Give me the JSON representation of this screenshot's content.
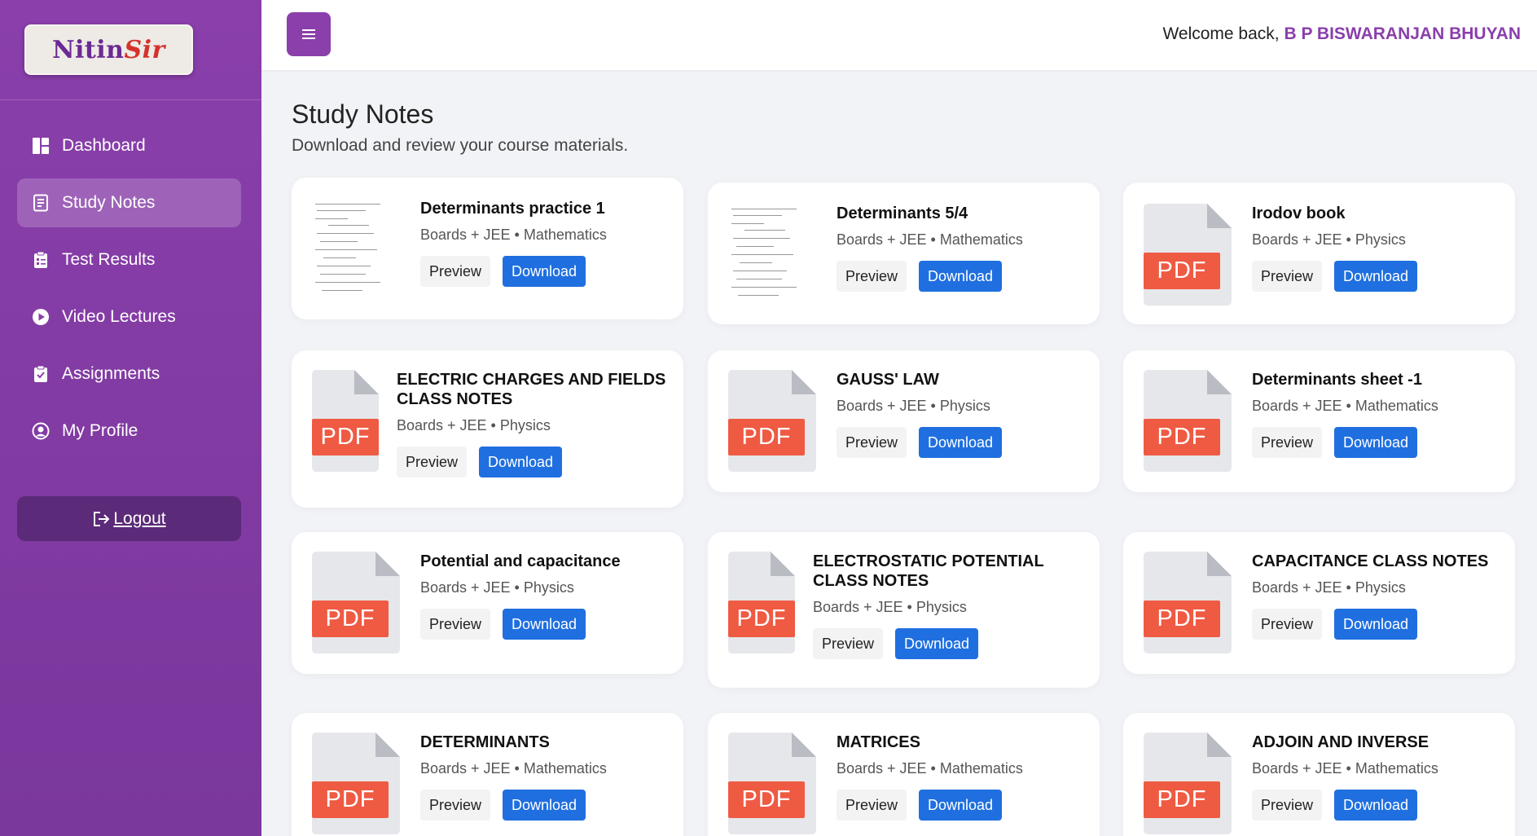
{
  "brand": {
    "logo_text_1": "Nitin",
    "logo_text_2": "Sir"
  },
  "sidebar": {
    "items": [
      {
        "label": "Dashboard",
        "icon": "dashboard-icon"
      },
      {
        "label": "Study Notes",
        "icon": "notes-icon",
        "active": true
      },
      {
        "label": "Test Results",
        "icon": "clipboard-icon"
      },
      {
        "label": "Video Lectures",
        "icon": "play-icon"
      },
      {
        "label": "Assignments",
        "icon": "assignment-icon"
      },
      {
        "label": "My Profile",
        "icon": "profile-icon"
      }
    ],
    "logout": "Logout"
  },
  "header": {
    "welcome": "Welcome back, ",
    "user": "B P BISWARANJAN BHUYAN"
  },
  "page": {
    "title": "Study Notes",
    "subtitle": "Download and review your course materials."
  },
  "buttons": {
    "preview": "Preview",
    "download": "Download"
  },
  "thumb": {
    "pdf_label": "PDF"
  },
  "notes": [
    {
      "title": "Determinants practice 1",
      "meta": "Boards + JEE • Mathematics",
      "thumb": "document"
    },
    {
      "title": "Determinants 5/4",
      "meta": "Boards + JEE • Mathematics",
      "thumb": "document"
    },
    {
      "title": "Irodov book",
      "meta": "Boards + JEE • Physics",
      "thumb": "pdf"
    },
    {
      "title": "ELECTRIC CHARGES AND FIELDS CLASS NOTES",
      "meta": "Boards + JEE • Physics",
      "thumb": "pdf"
    },
    {
      "title": "GAUSS' LAW",
      "meta": "Boards + JEE • Physics",
      "thumb": "pdf"
    },
    {
      "title": "Determinants sheet -1",
      "meta": "Boards + JEE • Mathematics",
      "thumb": "pdf"
    },
    {
      "title": "Potential and capacitance",
      "meta": "Boards + JEE • Physics",
      "thumb": "pdf"
    },
    {
      "title": "ELECTROSTATIC POTENTIAL CLASS NOTES",
      "meta": "Boards + JEE • Physics",
      "thumb": "pdf"
    },
    {
      "title": "CAPACITANCE CLASS NOTES",
      "meta": "Boards + JEE • Physics",
      "thumb": "pdf"
    },
    {
      "title": "DETERMINANTS",
      "meta": "Boards + JEE • Mathematics",
      "thumb": "pdf"
    },
    {
      "title": "MATRICES",
      "meta": "Boards + JEE • Mathematics",
      "thumb": "pdf"
    },
    {
      "title": "ADJOIN AND INVERSE",
      "meta": "Boards + JEE • Mathematics",
      "thumb": "pdf"
    }
  ]
}
